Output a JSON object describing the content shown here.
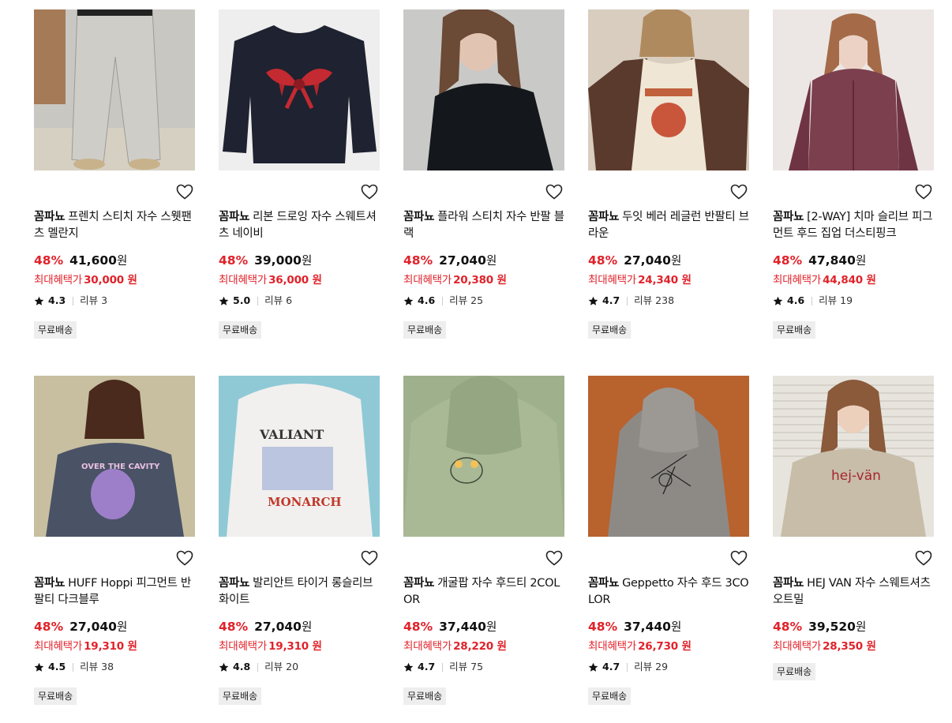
{
  "products": [
    {
      "brand": "꼼파뇨",
      "name": "프렌치 스티치 자수 스웻팬츠 멜란지",
      "discount": "48%",
      "price": "41,600",
      "won": "원",
      "benefit_label": "최대혜택가",
      "benefit_price": "30,000 원",
      "rating": "4.3",
      "review_label": "리뷰",
      "review_count": "3",
      "badge": "무료배송",
      "image": "gray-sweatpants",
      "image_colors": [
        "#c9c7c2",
        "#a8a59e"
      ]
    },
    {
      "brand": "꼼파뇨",
      "name": "리본 드로잉 자수 스웨트셔츠 네이비",
      "discount": "48%",
      "price": "39,000",
      "won": "원",
      "benefit_label": "최대혜택가",
      "benefit_price": "36,000 원",
      "rating": "5.0",
      "review_label": "리뷰",
      "review_count": "6",
      "badge": "무료배송",
      "image": "navy-sweatshirt-red-bow",
      "image_colors": [
        "#eeeeee",
        "#1f2230"
      ]
    },
    {
      "brand": "꼼파뇨",
      "name": "플라워 스티치 자수 반팔 블랙",
      "discount": "48%",
      "price": "27,040",
      "won": "원",
      "benefit_label": "최대혜택가",
      "benefit_price": "20,380 원",
      "rating": "4.6",
      "review_label": "리뷰",
      "review_count": "25",
      "badge": "무료배송",
      "image": "black-tshirt-model",
      "image_colors": [
        "#c9c9c7",
        "#14171c"
      ]
    },
    {
      "brand": "꼼파뇨",
      "name": "두잇 베러 레글런 반팔티 브라운",
      "discount": "48%",
      "price": "27,040",
      "won": "원",
      "benefit_label": "최대혜택가",
      "benefit_price": "24,340 원",
      "rating": "4.7",
      "review_label": "리뷰",
      "review_count": "238",
      "badge": "무료배송",
      "image": "brown-raglan-tee",
      "image_colors": [
        "#d8cdbf",
        "#5a3a2c"
      ]
    },
    {
      "brand": "꼼파뇨",
      "name": "[2-WAY] 치마 슬리브 피그먼트 후드 집업 더스티핑크",
      "discount": "48%",
      "price": "47,840",
      "won": "원",
      "benefit_label": "최대혜택가",
      "benefit_price": "44,840 원",
      "rating": "4.6",
      "review_label": "리뷰",
      "review_count": "19",
      "badge": "무료배송",
      "image": "dusty-pink-hoodie",
      "image_colors": [
        "#ece7e4",
        "#7c3f4e"
      ]
    },
    {
      "brand": "꼼파뇨",
      "name": "HUFF Hoppi 피그먼트 반팔티 다크블루",
      "discount": "48%",
      "price": "27,040",
      "won": "원",
      "benefit_label": "최대혜택가",
      "benefit_price": "19,310 원",
      "rating": "4.5",
      "review_label": "리뷰",
      "review_count": "38",
      "badge": "무료배송",
      "image": "dark-blue-tee",
      "image_colors": [
        "#c7bfa0",
        "#4a5266"
      ]
    },
    {
      "brand": "꼼파뇨",
      "name": "발리안트 타이거 롱슬리브 화이트",
      "discount": "48%",
      "price": "27,040",
      "won": "원",
      "benefit_label": "최대혜택가",
      "benefit_price": "19,310 원",
      "rating": "4.8",
      "review_label": "리뷰",
      "review_count": "20",
      "badge": "무료배송",
      "image": "white-longsleeve",
      "image_colors": [
        "#8fc9d6",
        "#f1f0ee"
      ]
    },
    {
      "brand": "꼼파뇨",
      "name": "개굴팝 자수 후드티 2COLOR",
      "discount": "48%",
      "price": "37,440",
      "won": "원",
      "benefit_label": "최대혜택가",
      "benefit_price": "28,220 원",
      "rating": "4.7",
      "review_label": "리뷰",
      "review_count": "75",
      "badge": "무료배송",
      "image": "sage-green-hoodie",
      "image_colors": [
        "#9fb08c",
        "#a9b996"
      ]
    },
    {
      "brand": "꼼파뇨",
      "name": "Geppetto 자수 후드 3COLOR",
      "discount": "48%",
      "price": "37,440",
      "won": "원",
      "benefit_label": "최대혜택가",
      "benefit_price": "26,730 원",
      "rating": "4.7",
      "review_label": "리뷰",
      "review_count": "29",
      "badge": "무료배송",
      "image": "gray-hoodie-orange-bg",
      "image_colors": [
        "#b8622e",
        "#8d8a86"
      ]
    },
    {
      "brand": "꼼파뇨",
      "name": "HEJ VAN 자수 스웨트셔츠 오트밀",
      "discount": "48%",
      "price": "39,520",
      "won": "원",
      "benefit_label": "최대혜택가",
      "benefit_price": "28,350 원",
      "rating": "",
      "review_label": "",
      "review_count": "",
      "badge": "무료배송",
      "image": "oatmeal-sweatshirt",
      "image_colors": [
        "#e7e4de",
        "#c7bda9"
      ],
      "image_text": "hej-vän"
    }
  ]
}
